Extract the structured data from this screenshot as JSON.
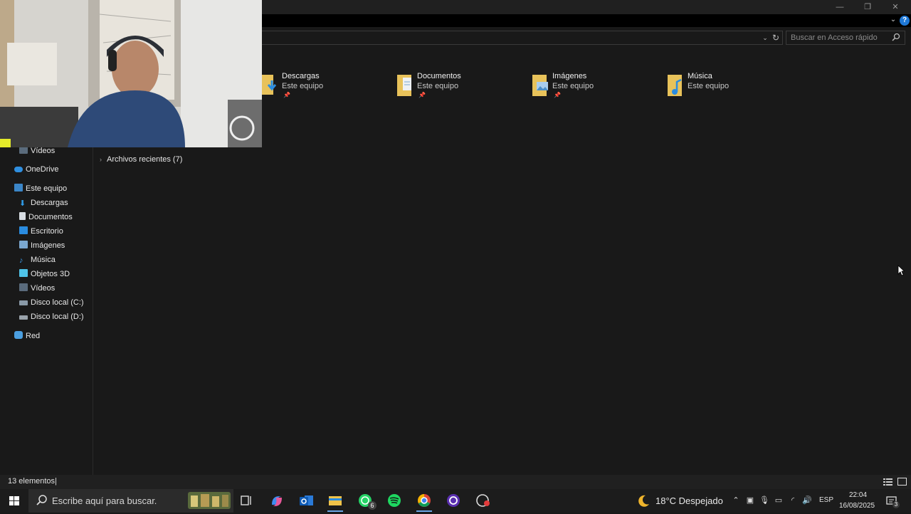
{
  "window": {
    "minimize_glyph": "—",
    "restore_glyph": "❐",
    "close_glyph": "✕"
  },
  "ribbon": {
    "expand_glyph": "⌄",
    "help_glyph": "?"
  },
  "address": {
    "dropdown_glyph": "⌄",
    "refresh_glyph": "↻",
    "search_placeholder": "Buscar en Acceso rápido"
  },
  "sidebar": {
    "items": [
      {
        "label": "Vídeos",
        "icon": "video-folder-icon"
      },
      {
        "label": "OneDrive",
        "icon": "onedrive-cloud-icon"
      },
      {
        "label": "Este equipo",
        "icon": "computer-icon"
      },
      {
        "label": "Descargas",
        "icon": "download-arrow-icon"
      },
      {
        "label": "Documentos",
        "icon": "document-icon"
      },
      {
        "label": "Escritorio",
        "icon": "desktop-icon"
      },
      {
        "label": "Imágenes",
        "icon": "pictures-icon"
      },
      {
        "label": "Música",
        "icon": "music-note-icon"
      },
      {
        "label": "Objetos 3D",
        "icon": "cube-3d-icon"
      },
      {
        "label": "Vídeos",
        "icon": "video-folder-icon"
      },
      {
        "label": "Disco local (C:)",
        "icon": "windows-drive-icon"
      },
      {
        "label": "Disco local (D:)",
        "icon": "drive-icon"
      },
      {
        "label": "Red",
        "icon": "network-icon"
      }
    ]
  },
  "quick_access": {
    "items": [
      {
        "name": "Descargas",
        "location": "Este equipo",
        "pin": "📌"
      },
      {
        "name": "Documentos",
        "location": "Este equipo",
        "pin": "📌"
      },
      {
        "name": "Imágenes",
        "location": "Este equipo",
        "pin": "📌"
      },
      {
        "name": "Música",
        "location": "Este equipo",
        "pin": ""
      }
    ],
    "recent_label": "Archivos recientes (7)",
    "recent_chevron": "›"
  },
  "status": {
    "count": "13 elementos",
    "separator": "|"
  },
  "taskbar": {
    "search_placeholder": "Escribe aquí para buscar.",
    "apps": [
      {
        "name": "task-view"
      },
      {
        "name": "copilot"
      },
      {
        "name": "outlook"
      },
      {
        "name": "file-explorer",
        "active": true
      },
      {
        "name": "whatsapp",
        "badge": "6"
      },
      {
        "name": "spotify"
      },
      {
        "name": "chrome",
        "active": true
      },
      {
        "name": "app-circle"
      },
      {
        "name": "recorder"
      }
    ],
    "weather": {
      "text": "18°C  Despejado",
      "icon": "moon-icon"
    },
    "language": "ESP",
    "time": "22:04",
    "date": "16/08/2025",
    "notification_count": "3",
    "tray_glyphs": {
      "chevron": "⌃",
      "meet": "▣",
      "mic": "🎙",
      "battery": "▭",
      "wifi": "◜",
      "volume": "🔊"
    }
  }
}
